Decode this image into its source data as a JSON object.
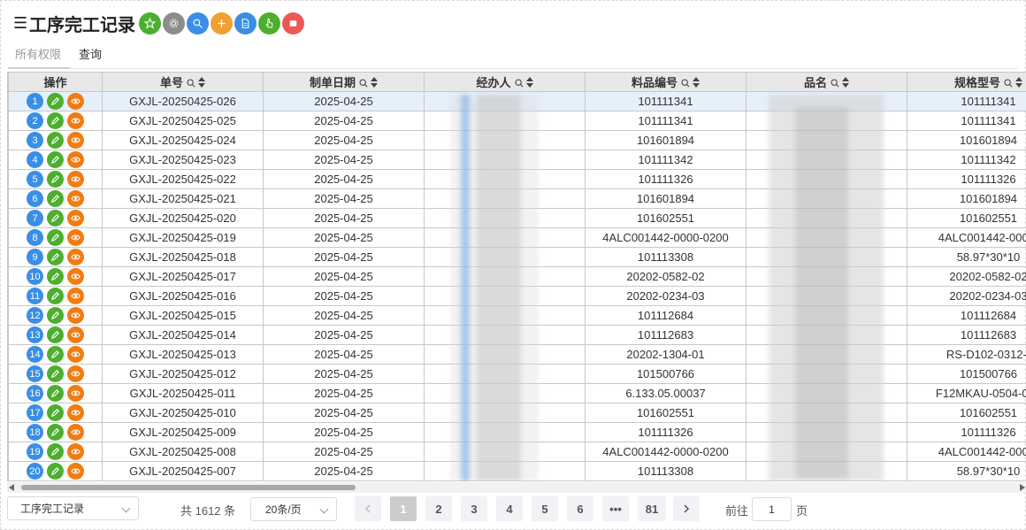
{
  "header": {
    "title": "工序完工记录",
    "buttons": [
      {
        "name": "favorite-button",
        "icon": "star-icon",
        "color": "#4caf2e"
      },
      {
        "name": "settings-button",
        "icon": "gear-icon",
        "color": "#8c8c8c"
      },
      {
        "name": "search-button",
        "icon": "search-icon",
        "color": "#3a8ee6"
      },
      {
        "name": "add-button",
        "icon": "plus-icon",
        "color": "#f0a030"
      },
      {
        "name": "export-button",
        "icon": "document-icon",
        "color": "#3a8ee6"
      },
      {
        "name": "hand-button",
        "icon": "hand-icon",
        "color": "#4caf2e"
      },
      {
        "name": "close-button",
        "icon": "close-icon",
        "color": "#f05858"
      }
    ]
  },
  "tabs": [
    {
      "label": "所有权限",
      "active": true
    },
    {
      "label": "查询",
      "active": false
    }
  ],
  "table": {
    "columns": [
      {
        "label": "操作",
        "search": false,
        "sort": false
      },
      {
        "label": "单号",
        "search": true,
        "sort": true
      },
      {
        "label": "制单日期",
        "search": true,
        "sort": true
      },
      {
        "label": "经办人",
        "search": true,
        "sort": true
      },
      {
        "label": "料品编号",
        "search": true,
        "sort": true
      },
      {
        "label": "品名",
        "search": true,
        "sort": true
      },
      {
        "label": "规格型号",
        "search": true,
        "sort": true
      }
    ],
    "rows": [
      {
        "no": "1",
        "order": "GXJL-20250425-026",
        "date": "2025-04-25",
        "handler": "",
        "code": "101111341",
        "name": "",
        "spec": "101111341"
      },
      {
        "no": "2",
        "order": "GXJL-20250425-025",
        "date": "2025-04-25",
        "handler": "",
        "code": "101111341",
        "name": "",
        "spec": "101111341"
      },
      {
        "no": "3",
        "order": "GXJL-20250425-024",
        "date": "2025-04-25",
        "handler": "",
        "code": "101601894",
        "name": "",
        "spec": "101601894"
      },
      {
        "no": "4",
        "order": "GXJL-20250425-023",
        "date": "2025-04-25",
        "handler": "",
        "code": "101111342",
        "name": "",
        "spec": "101111342"
      },
      {
        "no": "5",
        "order": "GXJL-20250425-022",
        "date": "2025-04-25",
        "handler": "",
        "code": "101111326",
        "name": "",
        "spec": "101111326"
      },
      {
        "no": "6",
        "order": "GXJL-20250425-021",
        "date": "2025-04-25",
        "handler": "",
        "code": "101601894",
        "name": "",
        "spec": "101601894"
      },
      {
        "no": "7",
        "order": "GXJL-20250425-020",
        "date": "2025-04-25",
        "handler": "",
        "code": "101602551",
        "name": "",
        "spec": "101602551"
      },
      {
        "no": "8",
        "order": "GXJL-20250425-019",
        "date": "2025-04-25",
        "handler": "",
        "code": "4ALC001442-0000-0200",
        "name": "",
        "spec": "4ALC001442-0000-"
      },
      {
        "no": "9",
        "order": "GXJL-20250425-018",
        "date": "2025-04-25",
        "handler": "",
        "code": "101113308",
        "name": "",
        "spec": "58.97*30*10"
      },
      {
        "no": "10",
        "order": "GXJL-20250425-017",
        "date": "2025-04-25",
        "handler": "",
        "code": "20202-0582-02",
        "name": "",
        "spec": "20202-0582-02"
      },
      {
        "no": "11",
        "order": "GXJL-20250425-016",
        "date": "2025-04-25",
        "handler": "",
        "code": "20202-0234-03",
        "name": "",
        "spec": "20202-0234-03"
      },
      {
        "no": "12",
        "order": "GXJL-20250425-015",
        "date": "2025-04-25",
        "handler": "",
        "code": "101112684",
        "name": "",
        "spec": "101112684"
      },
      {
        "no": "13",
        "order": "GXJL-20250425-014",
        "date": "2025-04-25",
        "handler": "",
        "code": "101112683",
        "name": "",
        "spec": "101112683"
      },
      {
        "no": "14",
        "order": "GXJL-20250425-013",
        "date": "2025-04-25",
        "handler": "",
        "code": "20202-1304-01",
        "name": "",
        "spec": "RS-D102-0312-("
      },
      {
        "no": "15",
        "order": "GXJL-20250425-012",
        "date": "2025-04-25",
        "handler": "",
        "code": "101500766",
        "name": "",
        "spec": "101500766"
      },
      {
        "no": "16",
        "order": "GXJL-20250425-011",
        "date": "2025-04-25",
        "handler": "",
        "code": "6.133.05.00037",
        "name": "",
        "spec": "F12MKAU-0504-000"
      },
      {
        "no": "17",
        "order": "GXJL-20250425-010",
        "date": "2025-04-25",
        "handler": "",
        "code": "101602551",
        "name": "",
        "spec": "101602551"
      },
      {
        "no": "18",
        "order": "GXJL-20250425-009",
        "date": "2025-04-25",
        "handler": "",
        "code": "101111326",
        "name": "",
        "spec": "101111326"
      },
      {
        "no": "19",
        "order": "GXJL-20250425-008",
        "date": "2025-04-25",
        "handler": "",
        "code": "4ALC001442-0000-0200",
        "name": "",
        "spec": "4ALC001442-0000-"
      },
      {
        "no": "20",
        "order": "GXJL-20250425-007",
        "date": "2025-04-25",
        "handler": "",
        "code": "101113308",
        "name": "",
        "spec": "58.97*30*10"
      }
    ]
  },
  "pager": {
    "view_select": "工序完工记录",
    "total": "共 1612 条",
    "page_size": "20条/页",
    "pages": [
      "1",
      "2",
      "3",
      "4",
      "5",
      "6",
      "•••",
      "81"
    ],
    "current_page": "1",
    "goto_label": "前往",
    "goto_value": "1",
    "page_suffix": "页"
  },
  "colors": {
    "accent": "#3a8ee6",
    "edit": "#4caf2e",
    "view": "#f07c12",
    "selected_row": "#e6f0fb",
    "header_bg": "#e8e8e8"
  }
}
